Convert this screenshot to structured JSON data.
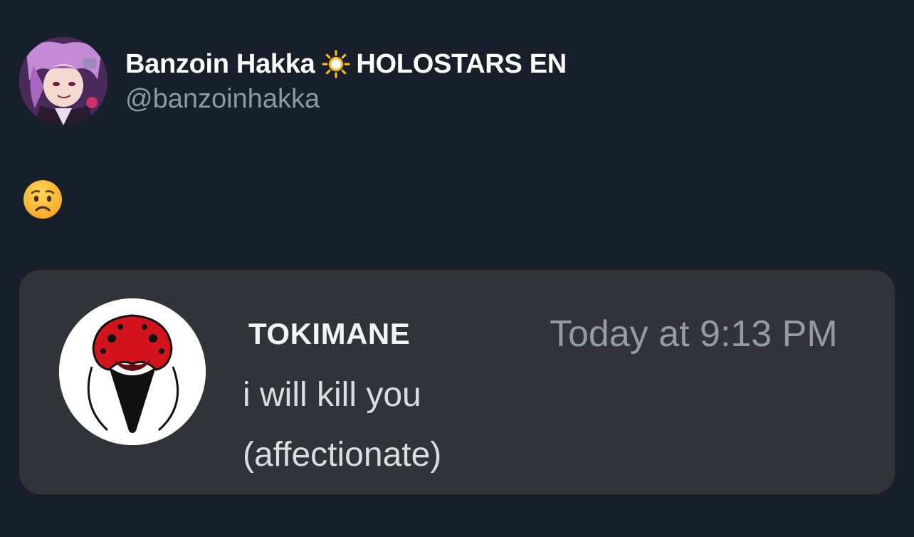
{
  "post": {
    "display_name": "Banzoin Hakka",
    "name_suffix": "HOLOSTARS EN",
    "name_icon": "sun-icon",
    "handle": "@banzoinhakka",
    "body_emoji": "worried-face-emoji"
  },
  "embed": {
    "username": "TOKIMANE",
    "timestamp": "Today at 9:13 PM",
    "message_line1": "i will kill you",
    "message_line2": "(affectionate)",
    "avatar_icon": "red-masked-bird-avatar"
  },
  "colors": {
    "background": "#17202a",
    "card_background": "#313338",
    "handle": "#8b98a5",
    "timestamp": "#949ba4",
    "accent_sun": "#f5b81c",
    "avatar_red": "#d4141c"
  }
}
